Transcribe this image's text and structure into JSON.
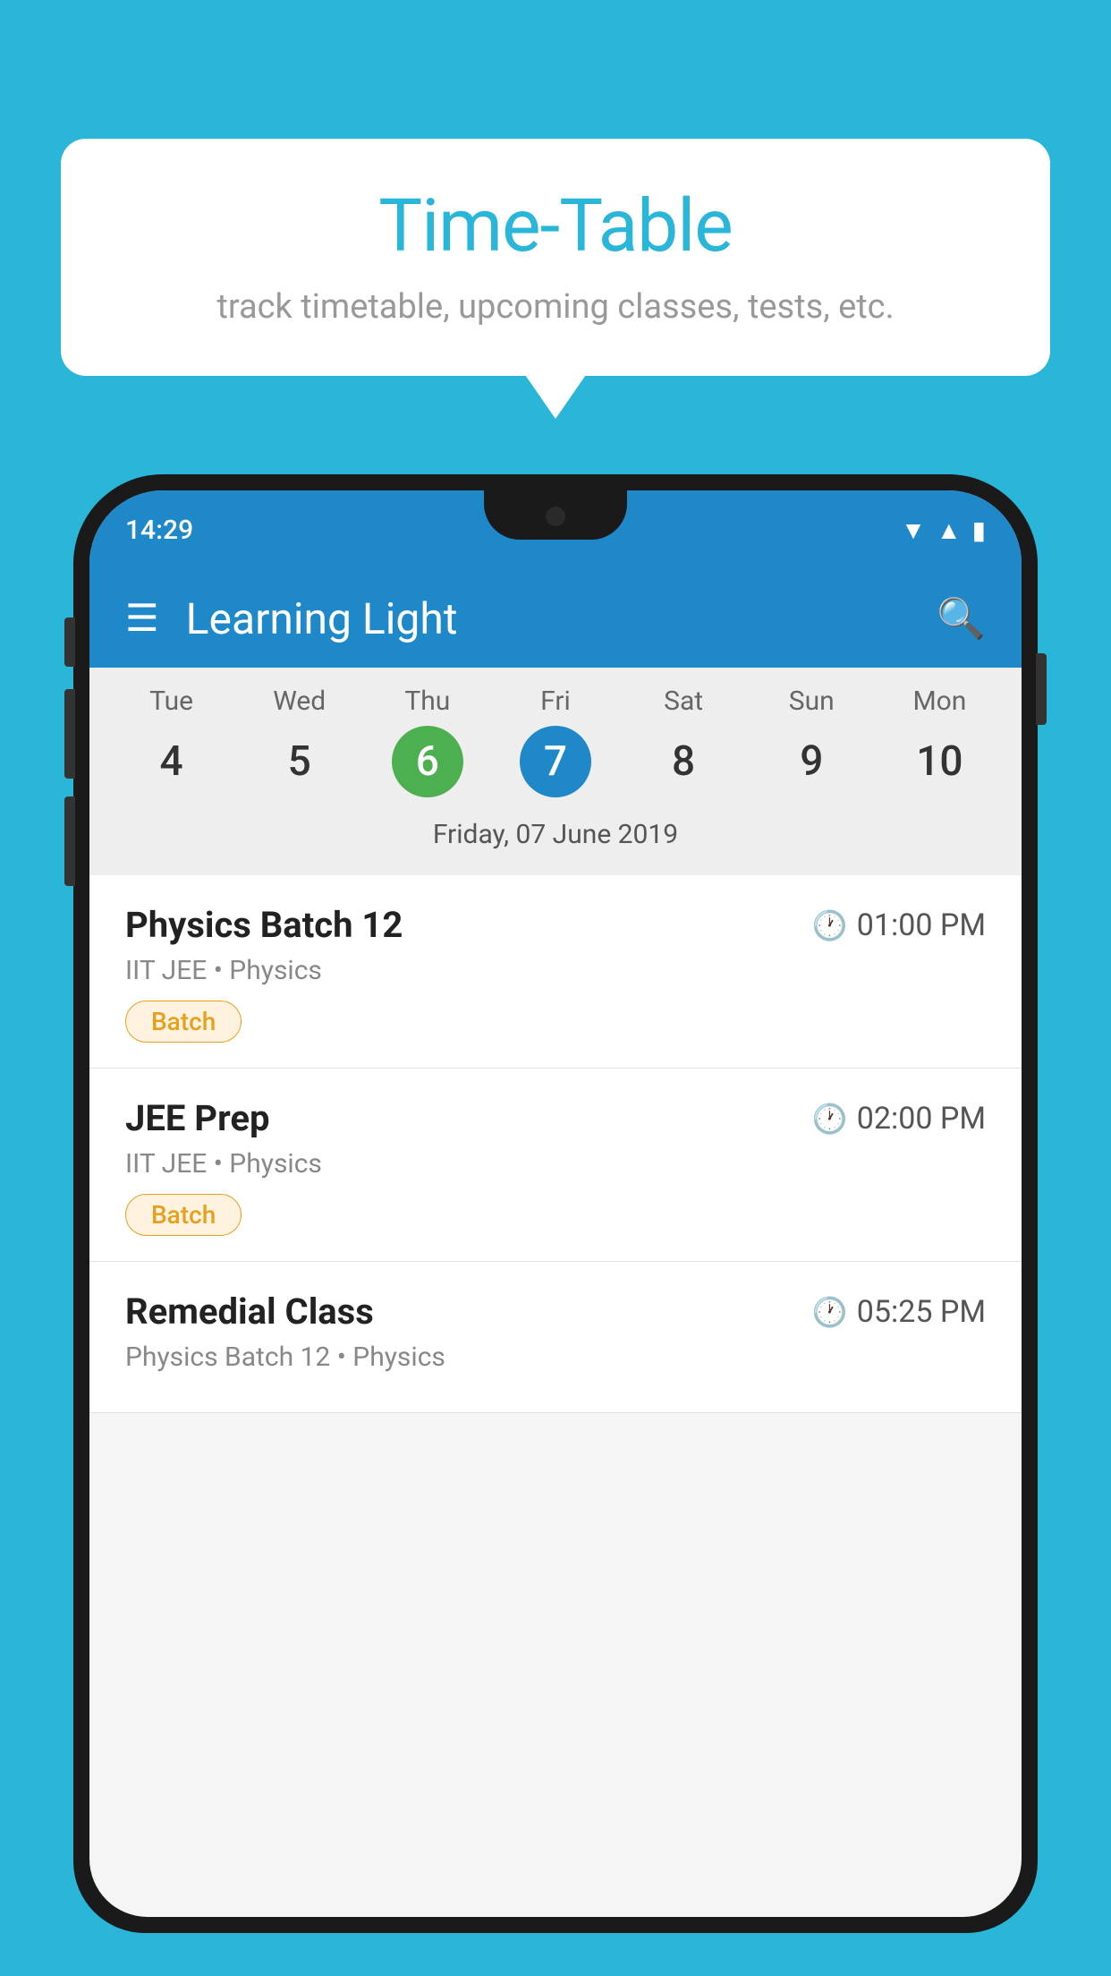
{
  "background_color": "#29b6d8",
  "bubble": {
    "title": "Time-Table",
    "subtitle": "track timetable, upcoming classes, tests, etc."
  },
  "phone": {
    "status_bar": {
      "time": "14:29"
    },
    "app_header": {
      "title": "Learning Light"
    },
    "calendar": {
      "days": [
        {
          "name": "Tue",
          "number": "4",
          "state": "normal"
        },
        {
          "name": "Wed",
          "number": "5",
          "state": "normal"
        },
        {
          "name": "Thu",
          "number": "6",
          "state": "today"
        },
        {
          "name": "Fri",
          "number": "7",
          "state": "selected"
        },
        {
          "name": "Sat",
          "number": "8",
          "state": "normal"
        },
        {
          "name": "Sun",
          "number": "9",
          "state": "normal"
        },
        {
          "name": "Mon",
          "number": "10",
          "state": "normal"
        }
      ],
      "selected_date_label": "Friday, 07 June 2019"
    },
    "classes": [
      {
        "name": "Physics Batch 12",
        "time": "01:00 PM",
        "meta": "IIT JEE • Physics",
        "badge": "Batch"
      },
      {
        "name": "JEE Prep",
        "time": "02:00 PM",
        "meta": "IIT JEE • Physics",
        "badge": "Batch"
      },
      {
        "name": "Remedial Class",
        "time": "05:25 PM",
        "meta": "Physics Batch 12 • Physics",
        "badge": ""
      }
    ]
  }
}
